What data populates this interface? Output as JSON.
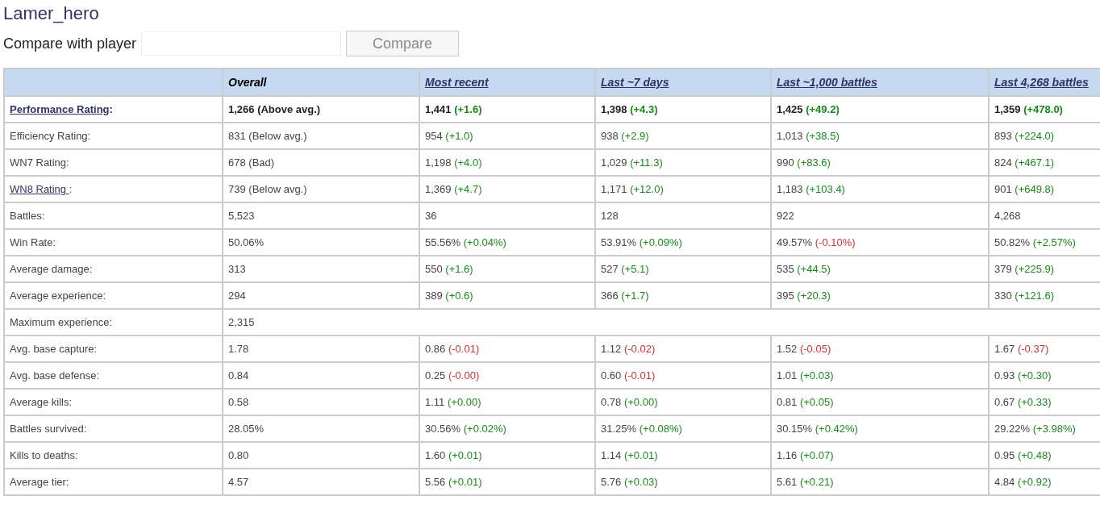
{
  "player": {
    "name": "Lamer_hero"
  },
  "compare": {
    "label": "Compare with player",
    "button": "Compare",
    "button_disabled": true
  },
  "table": {
    "columns": [
      {
        "label": "Overall",
        "link": false
      },
      {
        "label": "Most recent",
        "link": true
      },
      {
        "label": "Last ~7 days",
        "link": true
      },
      {
        "label": "Last ~1,000 battles",
        "link": true
      },
      {
        "label": "Last 4,268 battles",
        "link": true
      }
    ],
    "rows": [
      {
        "label": "Performance Rating",
        "suffix": ":",
        "link": true,
        "bold": true,
        "cells": [
          {
            "value": "1,266 (Above avg.)"
          },
          {
            "value": "1,441",
            "delta": "(+1.6)",
            "color": "#1a8a1a"
          },
          {
            "value": "1,398",
            "delta": "(+4.3)",
            "color": "#1a8a1a"
          },
          {
            "value": "1,425",
            "delta": "(+49.2)",
            "color": "#1a8a1a"
          },
          {
            "value": "1,359",
            "delta": "(+478.0)",
            "color": "#1a8a1a"
          }
        ]
      },
      {
        "label": "Efficiency Rating:",
        "link": false,
        "bold": false,
        "cells": [
          {
            "value": "831 (Below avg.)"
          },
          {
            "value": "954",
            "delta": "(+1.0)",
            "color": "#1a8a1a"
          },
          {
            "value": "938",
            "delta": "(+2.9)",
            "color": "#1a8a1a"
          },
          {
            "value": "1,013",
            "delta": "(+38.5)",
            "color": "#1a8a1a"
          },
          {
            "value": "893",
            "delta": "(+224.0)",
            "color": "#1a8a1a"
          }
        ]
      },
      {
        "label": "WN7 Rating:",
        "link": false,
        "bold": false,
        "cells": [
          {
            "value": "678 (Bad)"
          },
          {
            "value": "1,198",
            "delta": "(+4.0)",
            "color": "#1a8a1a"
          },
          {
            "value": "1,029",
            "delta": "(+11.3)",
            "color": "#1a8a1a"
          },
          {
            "value": "990",
            "delta": "(+83.6)",
            "color": "#1a8a1a"
          },
          {
            "value": "824",
            "delta": "(+467.1)",
            "color": "#1a8a1a"
          }
        ]
      },
      {
        "label": "WN8 Rating ",
        "suffix": ":",
        "link": true,
        "bold": false,
        "cells": [
          {
            "value": "739 (Below avg.)"
          },
          {
            "value": "1,369",
            "delta": "(+4.7)",
            "color": "#1a8a1a"
          },
          {
            "value": "1,171",
            "delta": "(+12.0)",
            "color": "#1a8a1a"
          },
          {
            "value": "1,183",
            "delta": "(+103.4)",
            "color": "#1a8a1a"
          },
          {
            "value": "901",
            "delta": "(+649.8)",
            "color": "#1a8a1a"
          }
        ]
      },
      {
        "label": "Battles:",
        "link": false,
        "bold": false,
        "cells": [
          {
            "value": "5,523"
          },
          {
            "value": "36"
          },
          {
            "value": "128"
          },
          {
            "value": "922"
          },
          {
            "value": "4,268"
          }
        ]
      },
      {
        "label": "Win Rate:",
        "link": false,
        "bold": false,
        "cells": [
          {
            "value": "50.06%"
          },
          {
            "value": "55.56%",
            "delta": "(+0.04%)",
            "color": "#1a8a1a"
          },
          {
            "value": "53.91%",
            "delta": "(+0.09%)",
            "color": "#1a8a1a"
          },
          {
            "value": "49.57%",
            "delta": "(-0.10%)",
            "color": "#cc3333"
          },
          {
            "value": "50.82%",
            "delta": "(+2.57%)",
            "color": "#1a8a1a"
          }
        ]
      },
      {
        "label": "Average damage:",
        "link": false,
        "bold": false,
        "cells": [
          {
            "value": "313"
          },
          {
            "value": "550",
            "delta": "(+1.6)",
            "color": "#1a8a1a"
          },
          {
            "value": "527",
            "delta": "(+5.1)",
            "color": "#1a8a1a"
          },
          {
            "value": "535",
            "delta": "(+44.5)",
            "color": "#1a8a1a"
          },
          {
            "value": "379",
            "delta": "(+225.9)",
            "color": "#1a8a1a"
          }
        ]
      },
      {
        "label": "Average experience:",
        "link": false,
        "bold": false,
        "cells": [
          {
            "value": "294"
          },
          {
            "value": "389",
            "delta": "(+0.6)",
            "color": "#1a8a1a"
          },
          {
            "value": "366",
            "delta": "(+1.7)",
            "color": "#1a8a1a"
          },
          {
            "value": "395",
            "delta": "(+20.3)",
            "color": "#1a8a1a"
          },
          {
            "value": "330",
            "delta": "(+121.6)",
            "color": "#1a8a1a"
          }
        ]
      },
      {
        "label": "Maximum experience:",
        "link": false,
        "bold": false,
        "cells": [
          {
            "value": "2,315"
          }
        ]
      },
      {
        "label": "Avg. base capture:",
        "link": false,
        "bold": false,
        "cells": [
          {
            "value": "1.78"
          },
          {
            "value": "0.86",
            "delta": "(-0.01)",
            "color": "#cc3333"
          },
          {
            "value": "1.12",
            "delta": "(-0.02)",
            "color": "#cc3333"
          },
          {
            "value": "1.52",
            "delta": "(-0.05)",
            "color": "#cc3333"
          },
          {
            "value": "1.67",
            "delta": "(-0.37)",
            "color": "#cc3333"
          }
        ]
      },
      {
        "label": "Avg. base defense:",
        "link": false,
        "bold": false,
        "cells": [
          {
            "value": "0.84"
          },
          {
            "value": "0.25",
            "delta": "(-0.00)",
            "color": "#cc3333"
          },
          {
            "value": "0.60",
            "delta": "(-0.01)",
            "color": "#cc3333"
          },
          {
            "value": "1.01",
            "delta": "(+0.03)",
            "color": "#1a8a1a"
          },
          {
            "value": "0.93",
            "delta": "(+0.30)",
            "color": "#1a8a1a"
          }
        ]
      },
      {
        "label": "Average kills:",
        "link": false,
        "bold": false,
        "cells": [
          {
            "value": "0.58"
          },
          {
            "value": "1.11",
            "delta": "(+0.00)",
            "color": "#1a8a1a"
          },
          {
            "value": "0.78",
            "delta": "(+0.00)",
            "color": "#1a8a1a"
          },
          {
            "value": "0.81",
            "delta": "(+0.05)",
            "color": "#1a8a1a"
          },
          {
            "value": "0.67",
            "delta": "(+0.33)",
            "color": "#1a8a1a"
          }
        ]
      },
      {
        "label": "Battles survived:",
        "link": false,
        "bold": false,
        "cells": [
          {
            "value": "28.05%"
          },
          {
            "value": "30.56%",
            "delta": "(+0.02%)",
            "color": "#1a8a1a"
          },
          {
            "value": "31.25%",
            "delta": "(+0.08%)",
            "color": "#1a8a1a"
          },
          {
            "value": "30.15%",
            "delta": "(+0.42%)",
            "color": "#1a8a1a"
          },
          {
            "value": "29.22%",
            "delta": "(+3.98%)",
            "color": "#1a8a1a"
          }
        ]
      },
      {
        "label": "Kills to deaths:",
        "link": false,
        "bold": false,
        "cells": [
          {
            "value": "0.80"
          },
          {
            "value": "1.60",
            "delta": "(+0.01)",
            "color": "#1a8a1a"
          },
          {
            "value": "1.14",
            "delta": "(+0.01)",
            "color": "#1a8a1a"
          },
          {
            "value": "1.16",
            "delta": "(+0.07)",
            "color": "#1a8a1a"
          },
          {
            "value": "0.95",
            "delta": "(+0.48)",
            "color": "#1a8a1a"
          }
        ]
      },
      {
        "label": "Average tier:",
        "link": false,
        "bold": false,
        "cells": [
          {
            "value": "4.57"
          },
          {
            "value": "5.56",
            "delta": "(+0.01)",
            "color": "#1a8a1a"
          },
          {
            "value": "5.76",
            "delta": "(+0.03)",
            "color": "#1a8a1a"
          },
          {
            "value": "5.61",
            "delta": "(+0.21)",
            "color": "#1a8a1a"
          },
          {
            "value": "4.84",
            "delta": "(+0.92)",
            "color": "#1a8a1a"
          }
        ]
      }
    ]
  }
}
